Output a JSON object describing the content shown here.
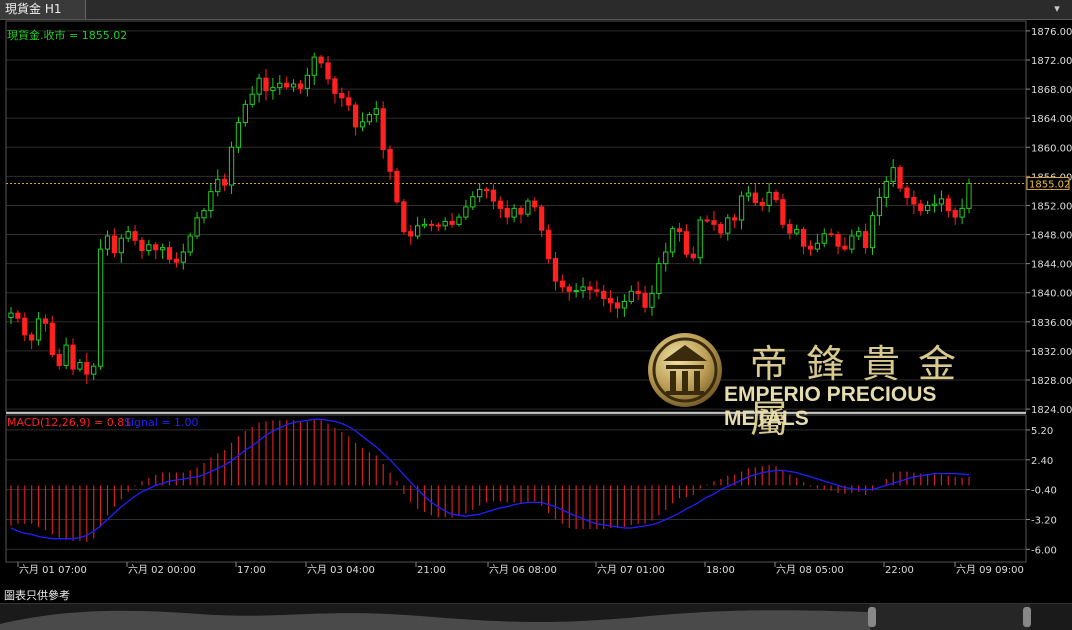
{
  "tab": {
    "title": "現貨金 H1"
  },
  "window_buttons": {
    "down": "▾",
    "up": "▴"
  },
  "price_panel": {
    "label": "現貨金.收市 = 1855.02",
    "current_price": 1855.02
  },
  "macd_panel": {
    "label_macd": "MACD(12,26,9) = 0.81",
    "label_signal": "Signal = 1.00"
  },
  "footer": {
    "note": "圖表只供參考"
  },
  "logo": {
    "chinese": "帝鋒貴金屬",
    "english": "EMPERIO PRECIOUS METALS"
  },
  "colors": {
    "up": "#22cc22",
    "down": "#ff2020",
    "macd_bar": "#d02020",
    "signal": "#2020ff",
    "price_line": "#d8a23a",
    "grid": "#2e2e2e",
    "label_green": "#22cc22",
    "label_red": "#ff2020"
  },
  "chart_data": [
    {
      "type": "candlestick",
      "price_axis": {
        "ylim": [
          1823.6,
          1877.5
        ],
        "ticks": [
          "1876.00",
          "1872.00",
          "1868.00",
          "1864.00",
          "1860.00",
          "1856.00",
          "1852.00",
          "1848.00",
          "1844.00",
          "1840.00",
          "1836.00",
          "1832.00",
          "1828.00",
          "1824.00"
        ]
      },
      "x_ticks": [
        "六月 01 07:00",
        "六月 02 00:00",
        "17:00",
        "六月 03 04:00",
        "21:00",
        "六月 06 08:00",
        "六月 07 01:00",
        "18:00",
        "六月 08 05:00",
        "22:00",
        "六月 09 09:00"
      ],
      "close_path": [
        1837.2,
        1836.5,
        1834.2,
        1833.5,
        1836.4,
        1835.8,
        1831.5,
        1830.0,
        1832.8,
        1829.5,
        1830.4,
        1828.8,
        1829.9,
        1846.0,
        1847.8,
        1845.5,
        1847.5,
        1848.4,
        1847.2,
        1845.8,
        1846.6,
        1845.9,
        1846.2,
        1844.6,
        1844.2,
        1845.6,
        1847.8,
        1850.3,
        1851.3,
        1853.9,
        1855.6,
        1854.8,
        1860.0,
        1863.4,
        1865.9,
        1867.3,
        1869.5,
        1867.8,
        1868.2,
        1868.8,
        1868.3,
        1868.7,
        1868.1,
        1869.9,
        1872.4,
        1871.6,
        1869.4,
        1867.4,
        1866.8,
        1865.8,
        1862.8,
        1863.5,
        1864.5,
        1865.3,
        1859.7,
        1856.7,
        1852.5,
        1848.4,
        1847.8,
        1849.2,
        1849.4,
        1849.3,
        1849.2,
        1849.8,
        1849.4,
        1850.4,
        1851.8,
        1853.2,
        1854.2,
        1854.1,
        1852.6,
        1851.6,
        1850.4,
        1851.6,
        1850.8,
        1852.6,
        1851.8,
        1848.6,
        1844.7,
        1841.6,
        1840.8,
        1840.2,
        1840.3,
        1840.8,
        1840.4,
        1840.2,
        1839.2,
        1838.6,
        1837.9,
        1838.8,
        1840.2,
        1839.9,
        1838.0,
        1839.9,
        1844.0,
        1845.6,
        1848.8,
        1848.4,
        1845.3,
        1844.8,
        1850.0,
        1849.9,
        1849.4,
        1848.2,
        1850.3,
        1850.0,
        1853.3,
        1853.7,
        1852.4,
        1852.0,
        1853.8,
        1852.8,
        1849.4,
        1848.2,
        1848.7,
        1846.4,
        1846.0,
        1846.8,
        1848.1,
        1848.0,
        1846.4,
        1846.0,
        1847.8,
        1848.4,
        1846.2,
        1850.6,
        1853.1,
        1855.3,
        1857.2,
        1854.4,
        1853.1,
        1852.2,
        1851.3,
        1852.0,
        1852.2,
        1852.9,
        1851.3,
        1850.4,
        1851.6,
        1855.02
      ],
      "last_close": 1855.02
    },
    {
      "type": "bar+line",
      "name": "MACD(12,26,9)",
      "ylim": [
        -7.0,
        6.6
      ],
      "ticks": [
        "5.20",
        "2.40",
        "-0.40",
        "-3.20",
        "-6.00"
      ],
      "macd_bars": [
        -3.8,
        -3.6,
        -3.6,
        -3.6,
        -3.9,
        -4.2,
        -4.6,
        -4.9,
        -5.1,
        -5.2,
        -5.2,
        -5.3,
        -5.0,
        -3.9,
        -2.8,
        -2.0,
        -1.3,
        -0.6,
        -0.1,
        0.4,
        0.7,
        1.0,
        1.2,
        1.2,
        1.2,
        1.2,
        1.4,
        1.7,
        2.1,
        2.6,
        3.0,
        3.3,
        4.0,
        4.6,
        5.1,
        5.5,
        5.9,
        6.0,
        6.1,
        6.1,
        6.1,
        6.1,
        6.0,
        6.0,
        6.2,
        6.1,
        5.8,
        5.4,
        5.0,
        4.6,
        4.0,
        3.5,
        3.1,
        2.8,
        2.0,
        1.2,
        0.4,
        -0.8,
        -1.6,
        -2.2,
        -2.5,
        -2.8,
        -3.0,
        -3.0,
        -3.0,
        -2.9,
        -2.6,
        -2.3,
        -1.9,
        -1.6,
        -1.5,
        -1.5,
        -1.6,
        -1.6,
        -1.7,
        -1.5,
        -1.5,
        -1.9,
        -2.6,
        -3.2,
        -3.6,
        -4.0,
        -4.1,
        -4.1,
        -4.1,
        -4.1,
        -4.1,
        -4.0,
        -4.0,
        -3.9,
        -3.7,
        -3.6,
        -3.6,
        -3.3,
        -2.8,
        -2.3,
        -1.7,
        -1.2,
        -1.1,
        -0.9,
        -0.3,
        0.1,
        0.4,
        0.6,
        0.9,
        1.0,
        1.3,
        1.6,
        1.7,
        1.8,
        1.9,
        1.8,
        1.4,
        1.0,
        0.7,
        0.3,
        -0.1,
        -0.3,
        -0.4,
        -0.5,
        -0.7,
        -0.8,
        -0.7,
        -0.6,
        -0.9,
        -0.5,
        0.0,
        0.6,
        1.2,
        1.3,
        1.3,
        1.2,
        1.1,
        1.0,
        1.0,
        1.0,
        0.9,
        0.8,
        0.7,
        0.81
      ],
      "signal_line": [
        -4.0,
        -4.3,
        -4.5,
        -4.6,
        -4.8,
        -4.9,
        -5.0,
        -5.0,
        -5.0,
        -5.0,
        -4.9,
        -4.7,
        -4.3,
        -3.8,
        -3.2,
        -2.6,
        -2.0,
        -1.5,
        -1.0,
        -0.6,
        -0.3,
        0.0,
        0.2,
        0.4,
        0.5,
        0.6,
        0.7,
        0.8,
        1.0,
        1.3,
        1.6,
        1.9,
        2.3,
        2.8,
        3.3,
        3.7,
        4.2,
        4.7,
        5.1,
        5.4,
        5.7,
        5.9,
        6.0,
        6.1,
        6.2,
        6.2,
        6.1,
        6.0,
        5.8,
        5.5,
        5.1,
        4.6,
        4.1,
        3.6,
        3.0,
        2.4,
        1.7,
        1.0,
        0.3,
        -0.4,
        -1.0,
        -1.6,
        -2.0,
        -2.4,
        -2.7,
        -2.8,
        -2.9,
        -2.8,
        -2.7,
        -2.5,
        -2.3,
        -2.1,
        -2.0,
        -1.8,
        -1.7,
        -1.6,
        -1.6,
        -1.6,
        -1.8,
        -2.0,
        -2.3,
        -2.6,
        -2.9,
        -3.1,
        -3.4,
        -3.6,
        -3.7,
        -3.8,
        -3.9,
        -4.0,
        -4.0,
        -3.9,
        -3.8,
        -3.7,
        -3.5,
        -3.2,
        -2.9,
        -2.6,
        -2.2,
        -1.9,
        -1.5,
        -1.1,
        -0.8,
        -0.4,
        -0.1,
        0.2,
        0.5,
        0.8,
        1.0,
        1.2,
        1.3,
        1.4,
        1.4,
        1.3,
        1.2,
        1.0,
        0.8,
        0.6,
        0.4,
        0.2,
        0.0,
        -0.2,
        -0.3,
        -0.4,
        -0.4,
        -0.4,
        -0.2,
        0.0,
        0.2,
        0.4,
        0.6,
        0.8,
        0.9,
        1.0,
        1.1,
        1.1,
        1.1,
        1.1,
        1.05,
        1.0
      ]
    }
  ]
}
